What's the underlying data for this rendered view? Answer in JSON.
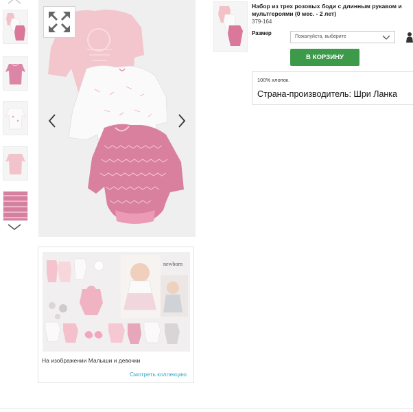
{
  "product": {
    "title": "Набор из трех розовых боди с длинным рукавом и мультгероями (0 мес. - 2 лет)",
    "code": "379-164",
    "size_label": "Размер",
    "size_placeholder": "Пожалуйста, выберите",
    "add_to_cart": "В КОРЗИНУ",
    "composition": "100% хлопок.",
    "country": "Страна-производитель: Шри Ланка"
  },
  "gallery": {
    "thumbnails": [
      "thumb-1",
      "thumb-2",
      "thumb-3",
      "thumb-4",
      "thumb-5"
    ],
    "icons": {
      "zoom": "expand-arrows-icon",
      "prev": "chevron-left-icon",
      "next": "chevron-right-icon",
      "up": "chevron-up-icon",
      "down": "chevron-down-icon"
    }
  },
  "promo": {
    "caption": "На изображении Малыши и девочки",
    "link": "Смотреть коллекцию",
    "brand_text": "newborn"
  },
  "colors": {
    "cart_button": "#3d9a4a",
    "link": "#3aa6c4",
    "pink": "#e07ba6",
    "light_pink": "#f4c6d3"
  }
}
